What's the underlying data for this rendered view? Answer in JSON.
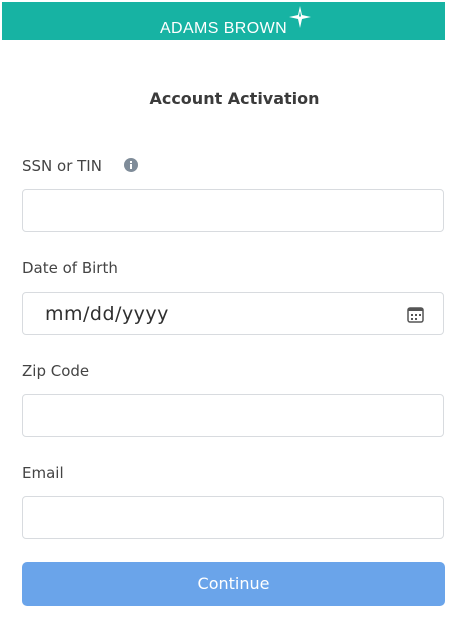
{
  "header": {
    "brand_name": "ADAMS BROWN",
    "brand_color": "#17b3a3",
    "logo_icon": "compass-star-icon"
  },
  "form": {
    "title": "Account Activation",
    "fields": {
      "ssn": {
        "label": "SSN or TIN",
        "value": "",
        "info_icon": "info-icon"
      },
      "dob": {
        "label": "Date of Birth",
        "placeholder": "mm/dd/yyyy",
        "icon": "calendar-icon"
      },
      "zip": {
        "label": "Zip Code",
        "value": ""
      },
      "email": {
        "label": "Email",
        "value": ""
      }
    },
    "submit_label": "Continue",
    "submit_color": "#6aa4ea"
  }
}
